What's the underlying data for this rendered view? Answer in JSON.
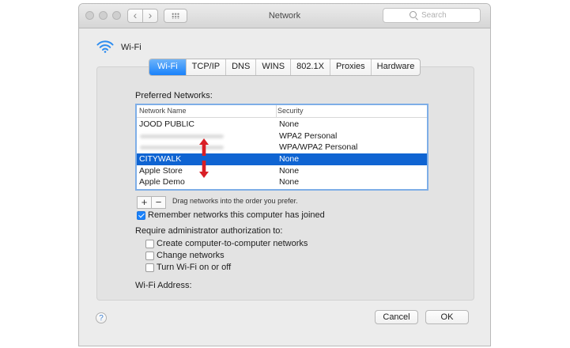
{
  "window": {
    "title": "Network"
  },
  "toolbar": {
    "search_placeholder": "Search",
    "back_icon": "chevron-left-icon",
    "forward_icon": "chevron-right-icon",
    "grid_icon": "grid-icon"
  },
  "header": {
    "label": "Wi-Fi",
    "icon": "wifi-icon"
  },
  "tabs": [
    {
      "label": "Wi-Fi",
      "selected": true
    },
    {
      "label": "TCP/IP",
      "selected": false
    },
    {
      "label": "DNS",
      "selected": false
    },
    {
      "label": "WINS",
      "selected": false
    },
    {
      "label": "802.1X",
      "selected": false
    },
    {
      "label": "Proxies",
      "selected": false
    },
    {
      "label": "Hardware",
      "selected": false
    }
  ],
  "preferred": {
    "label": "Preferred Networks:",
    "columns": [
      "Network Name",
      "Security"
    ],
    "rows": [
      {
        "name": "JOOD PUBLIC",
        "security": "None",
        "blurred": false,
        "selected": false
      },
      {
        "name": "",
        "security": "WPA2 Personal",
        "blurred": true,
        "selected": false
      },
      {
        "name": "",
        "security": "WPA/WPA2 Personal",
        "blurred": true,
        "selected": false
      },
      {
        "name": "CITYWALK",
        "security": "None",
        "blurred": false,
        "selected": true
      },
      {
        "name": "Apple Store",
        "security": "None",
        "blurred": false,
        "selected": false
      },
      {
        "name": "Apple Demo",
        "security": "None",
        "blurred": false,
        "selected": false
      }
    ],
    "add_label": "+",
    "remove_label": "−",
    "drag_hint": "Drag networks into the order you prefer."
  },
  "remember": {
    "label": "Remember networks this computer has joined",
    "checked": true
  },
  "admin": {
    "label": "Require administrator authorization to:",
    "options": [
      {
        "label": "Create computer-to-computer networks",
        "checked": false
      },
      {
        "label": "Change networks",
        "checked": false
      },
      {
        "label": "Turn Wi-Fi on or off",
        "checked": false
      }
    ]
  },
  "address": {
    "label": "Wi-Fi Address:"
  },
  "footer": {
    "help_label": "?",
    "cancel_label": "Cancel",
    "ok_label": "OK"
  },
  "colors": {
    "accent": "#1a82fb",
    "selection": "#0f64d2",
    "annotation_arrow": "#d91f26"
  }
}
